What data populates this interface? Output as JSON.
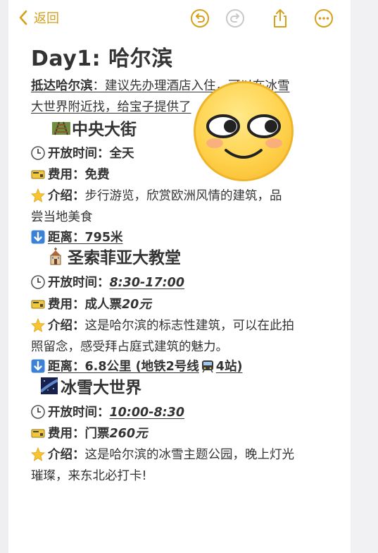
{
  "toolbar": {
    "back_label": "返回",
    "icons": [
      "chevron-left-icon",
      "undo-icon",
      "redo-icon",
      "share-icon",
      "more-icon"
    ],
    "accent_color": "#d6a01a"
  },
  "note": {
    "title": "Day1: 哈尔滨",
    "intro_label": "抵达哈尔滨",
    "intro_line1": "：建议先办理酒店入住，可以在冰雪",
    "intro_line2": "大世界附近找，给宝子提供了",
    "sections": [
      {
        "name": "中央大街",
        "icon": "railway-track-icon",
        "hours_label": "开放时间：",
        "hours_value": "全天",
        "fee_label": "费用：",
        "fee_value": "免费",
        "intro_label": "介绍：",
        "intro_line1": "步行游览，欣赏欧洲风情的建筑，品",
        "intro_line2": "尝当地美食",
        "distance_label": "距离：",
        "distance_value": "795米"
      },
      {
        "name": "圣索菲亚大教堂",
        "icon": "church-icon",
        "hours_label": "开放时间：",
        "hours_value": "8:30-17:00",
        "fee_label": "费用：",
        "fee_prefix": "成人票",
        "fee_value": "20元",
        "intro_label": "介绍：",
        "intro_line1": "这是哈尔滨的标志性建筑，可以在此拍",
        "intro_line2": "照留念，感受拜占庭式建筑的魅力。",
        "distance_label": "距离：",
        "distance_value": "6.8公里 (地铁2号线",
        "distance_suffix": "4站)"
      },
      {
        "name": "冰雪大世界",
        "icon": "milky-way-icon",
        "hours_label": "开放时间：",
        "hours_value": "10:00-8:30",
        "fee_label": "费用：",
        "fee_prefix": "门票",
        "fee_value": "260元",
        "intro_label": "介绍：",
        "intro_line1": "这是哈尔滨的冰雪主题公园，晚上灯光",
        "intro_line2": "璀璨，来东北必打卡!"
      }
    ]
  }
}
